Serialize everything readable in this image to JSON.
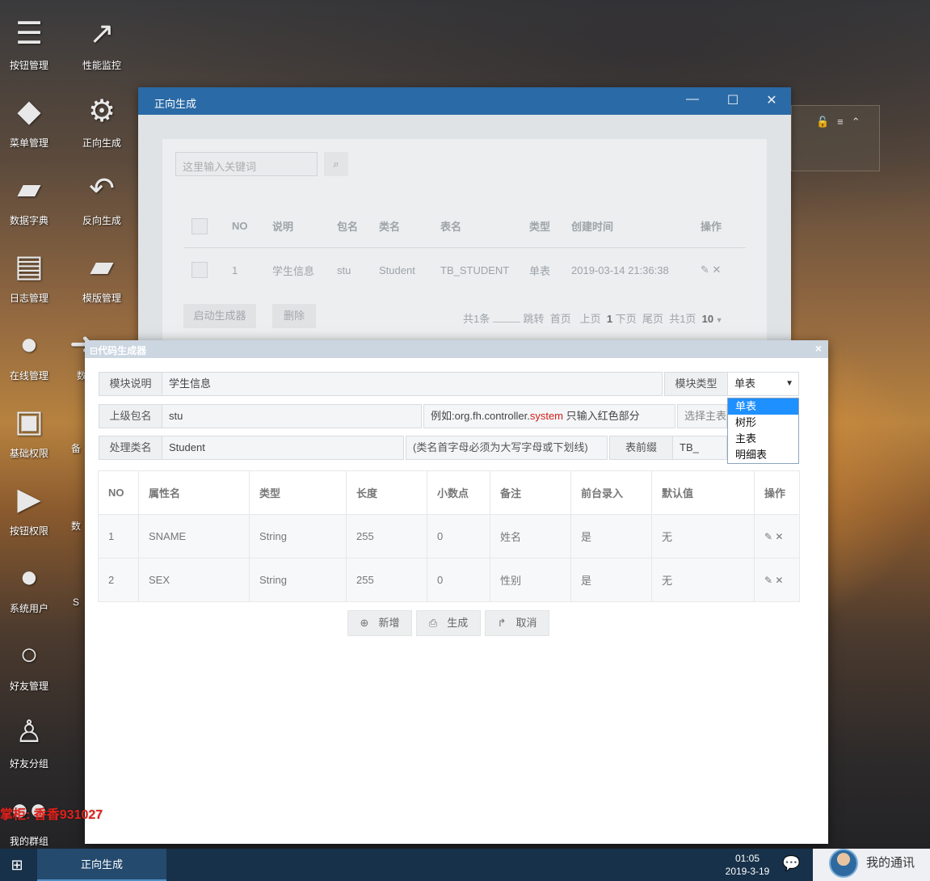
{
  "desktop": {
    "icons_col1": [
      {
        "label": "按钮管理",
        "icon": "server-icon"
      },
      {
        "label": "菜单管理",
        "icon": "tags-icon"
      },
      {
        "label": "数据字典",
        "icon": "book-icon"
      },
      {
        "label": "日志管理",
        "icon": "newspaper-icon"
      },
      {
        "label": "在线管理",
        "icon": "globe-icon"
      },
      {
        "label": "基础权限",
        "icon": "id-card-icon"
      },
      {
        "label": "按钮权限",
        "icon": "play-square-icon"
      },
      {
        "label": "系统用户",
        "icon": "user-icon"
      },
      {
        "label": "好友管理",
        "icon": "user-outline-icon"
      },
      {
        "label": "好友分组",
        "icon": "male-icon"
      },
      {
        "label": "我的群组",
        "icon": "users-icon"
      }
    ],
    "icons_col2": [
      {
        "label": "性能监控",
        "icon": "line-chart-icon"
      },
      {
        "label": "正向生成",
        "icon": "gear-icon"
      },
      {
        "label": "反向生成",
        "icon": "reply-icon"
      },
      {
        "label": "模版管理",
        "icon": "book-icon"
      }
    ],
    "partial_labels": {
      "row5": "数",
      "row6": "备",
      "row7": "数",
      "row8": "S"
    }
  },
  "back_window": {
    "title": "正向生成",
    "controls": {
      "minimize": "—",
      "maximize": "☐",
      "close": "✕"
    },
    "search": {
      "placeholder": "这里输入关键词"
    },
    "table": {
      "headers": [
        "NO",
        "说明",
        "包名",
        "类名",
        "表名",
        "类型",
        "创建时间",
        "操作"
      ],
      "rows": [
        {
          "no": "1",
          "desc": "学生信息",
          "pkg": "stu",
          "cls": "Student",
          "tbl": "TB_STUDENT",
          "type": "单表",
          "time": "2019-03-14 21:36:38"
        }
      ]
    },
    "buttons": {
      "start": "启动生成器",
      "delete": "删除"
    },
    "pager": {
      "total": "共1条",
      "jump": "跳转",
      "first": "首页",
      "prev": "上页",
      "current": "1",
      "next": "下页",
      "last": "尾页",
      "pages": "共1页",
      "size": "10"
    }
  },
  "dialog": {
    "title": "代码生成器",
    "close": "×",
    "form": {
      "module_desc_label": "模块说明",
      "module_desc_value": "学生信息",
      "module_type_label": "模块类型",
      "module_type_value": "单表",
      "module_type_options": [
        "单表",
        "树形",
        "主表",
        "明细表"
      ],
      "package_label": "上级包名",
      "package_value": "stu",
      "package_hint_prefix": "例如:org.fh.controller.",
      "package_hint_red": "system",
      "package_hint_suffix": " 只输入红色部分",
      "choose_main_table": "选择主表",
      "class_label": "处理类名",
      "class_value": "Student",
      "class_hint": "(类名首字母必须为大写字母或下划线)",
      "prefix_label": "表前缀",
      "prefix_value": "TB_"
    },
    "table": {
      "headers": [
        "NO",
        "属性名",
        "类型",
        "长度",
        "小数点",
        "备注",
        "前台录入",
        "默认值",
        "操作"
      ],
      "rows": [
        {
          "no": "1",
          "name": "SNAME",
          "type": "String",
          "len": "255",
          "dec": "0",
          "note": "姓名",
          "input": "是",
          "def": "无"
        },
        {
          "no": "2",
          "name": "SEX",
          "type": "String",
          "len": "255",
          "dec": "0",
          "note": "性别",
          "input": "是",
          "def": "无"
        }
      ]
    },
    "buttons": {
      "add": "新增",
      "generate": "生成",
      "cancel": "取消"
    }
  },
  "watermark": "掌柜: 香香931027",
  "taskbar": {
    "active_task": "正向生成",
    "time": "01:05",
    "date": "2019-3-19",
    "contact": "我的通讯"
  }
}
